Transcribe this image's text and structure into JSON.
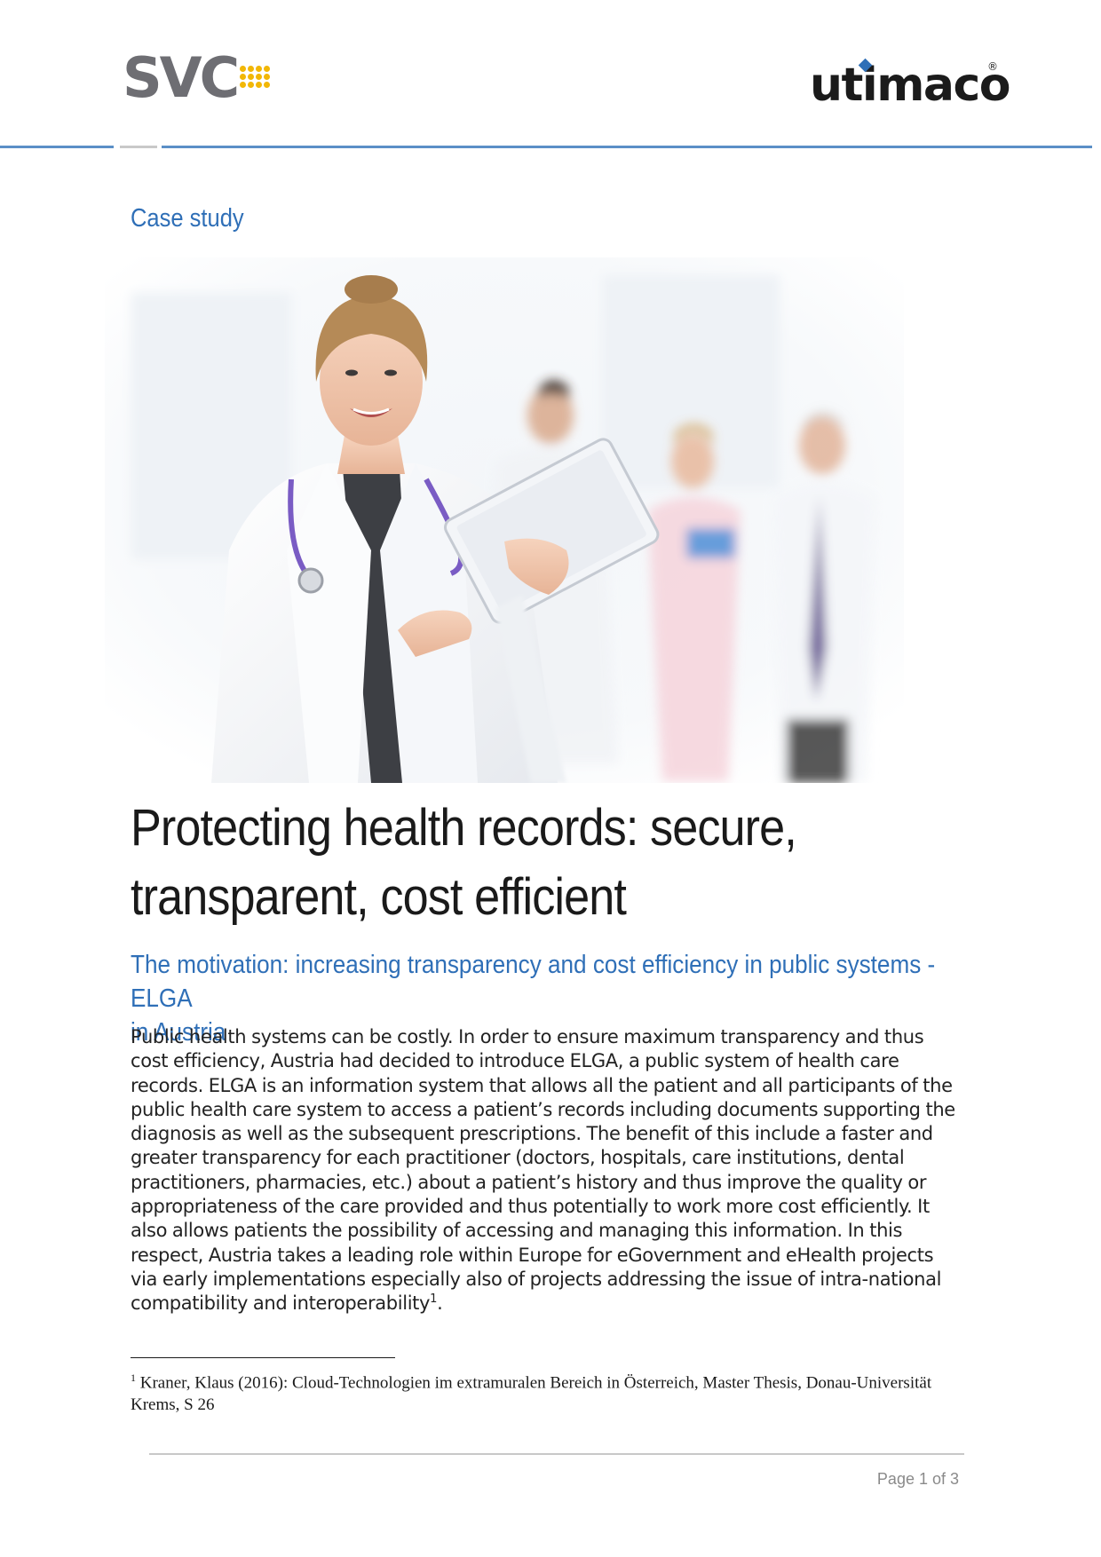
{
  "header": {
    "left_logo": "SVC",
    "right_logo": "utimaco",
    "right_logo_mark": "®",
    "brand_colors": {
      "accent_blue": "#2f6fb7",
      "svc_yellow": "#f2b705",
      "svc_grey": "#6e6e73"
    }
  },
  "section_label": "Case study",
  "hero_image": {
    "icon": "doctor-photo-illustration"
  },
  "title_lines": [
    "Protecting health records: secure,",
    "transparent, cost efficient"
  ],
  "subtitle_lines": [
    "The motivation: increasing transparency and cost efficiency in public systems - ELGA",
    "in Austria"
  ],
  "body": {
    "paragraph": "Public health systems can be costly. In order to ensure maximum transparency and thus cost efficiency, Austria had decided to introduce ELGA, a public system of health care records. ELGA is an information system that allows all the patient and all participants of the public health care system to access a patient’s records including documents supporting the diagnosis as well as the subsequent prescriptions. The benefit of this include a faster and greater transparency for each practitioner (doctors, hospitals, care institutions, dental practitioners, pharmacies, etc.) about a patient’s history and thus improve the quality or appropriateness of the care provided and thus potentially to work more cost efficiently. It also allows patients the possibility of accessing and managing this information. In this respect, Austria takes a leading role within Europe for eGovernment and eHealth projects via early implementations especially also of projects addressing the issue of intra-national compatibility and interoperability",
    "footnote_ref": "1",
    "end": "."
  },
  "footnote": {
    "number": "1",
    "text": "Kraner, Klaus (2016): Cloud-Technologien im extramuralen Bereich in Österreich, Master Thesis, Donau-Universität Krems, S 26"
  },
  "footer": {
    "page_label": "Page 1 of 3"
  }
}
